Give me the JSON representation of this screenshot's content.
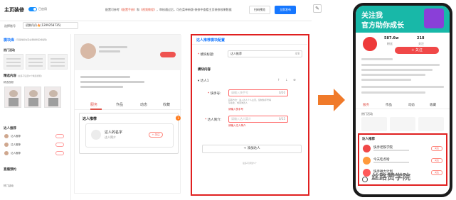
{
  "topbar": {
    "title": "主页装修",
    "enabled_label": "已启用",
    "notice_prefix": "配置可参考",
    "notice_link1": "《配置手册》",
    "notice_mid": "和",
    "notice_link2": "《视频教程》",
    "notice_suffix": "，审核通过后，可在菜单新版-装修中查看主页装修效果数据",
    "preview_button": "扫码预览",
    "publish_button": "立即发布"
  },
  "store": {
    "label": "选择账号",
    "value": "初鲜丹丹🔥(1209258735)"
  },
  "components": {
    "tab": "模块库",
    "desc": "(可拖拽模块至右侧精修区域编辑)",
    "hot_title": "热门活动",
    "section1": "精选内容",
    "section1_hint": "(最多可设置9个精选视频)",
    "section1_sub": "精选视频",
    "section2": "达人推荐",
    "section3": "直播预约",
    "items": [
      "达人推荐",
      "达人推荐",
      "达人推荐"
    ],
    "mini": "热门活动"
  },
  "preview": {
    "tabs": [
      "服务",
      "作品",
      "动态",
      "收藏"
    ],
    "section_title": "达人推荐",
    "card_name": "达人的名字",
    "card_intro": "达人简介",
    "follow": "+ 关注",
    "badge": "1"
  },
  "config": {
    "header": "达人推荐模块配置",
    "title_label": "模块标题:",
    "title_value": "达人推荐",
    "title_count": "4/8",
    "content_title": "模块内容",
    "talent_item": "达人1",
    "ctrl_up": "↑",
    "ctrl_down": "↓",
    "ctrl_del": "⊗",
    "kwai_label": "快手号:",
    "kwai_placeholder": "请输入快手号",
    "kwai_count": "0/20",
    "kwai_help": "获取方法：进入达人个人主页，复制快手号填写在此，或咨询达人",
    "kwai_error": "请输入快手号",
    "intro_label": "达人简介:",
    "intro_placeholder": "请输入达人简介",
    "intro_count": "0/15",
    "intro_error": "请输入达人简介",
    "add_button": "+ 添加达人",
    "max_note": "最多可添加5个"
  },
  "phone": {
    "banner_line1": "关注我",
    "banner_line2": "官方助你成长",
    "stats": [
      {
        "value": "587.6w",
        "label": "粉丝"
      },
      {
        "value": "218",
        "label": "关注"
      }
    ],
    "follow": "+ 关注",
    "tabs": [
      "服务",
      "作品",
      "动态",
      "收藏"
    ],
    "hot": "热门活动",
    "rec_title": "达人推荐",
    "rows": [
      {
        "name": "快手老铁学院",
        "btn": "关注"
      },
      {
        "name": "今天吃点啥",
        "btn": "关注"
      },
      {
        "name": "快手磁力计划",
        "btn": "关注"
      }
    ]
  },
  "watermark": "丝路赞学院"
}
